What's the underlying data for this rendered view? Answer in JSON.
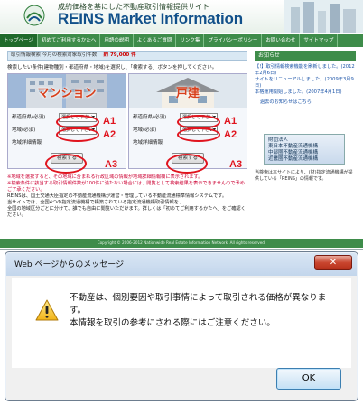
{
  "header": {
    "tagline": "成約価格を基にした不動産取引情報提供サイト",
    "brand": "REINS Market Information"
  },
  "nav": {
    "items": [
      "トップページ",
      "初めてご利用するかたへ",
      "用語の説明",
      "よくあるご質問",
      "リンク集",
      "プライバシーポリシー",
      "お問い合わせ",
      "サイトマップ"
    ]
  },
  "main": {
    "count_label": "取引情報検索",
    "count_text": "今月の検索対象取引件数：",
    "count_value": "約 79,000 件",
    "instruction": "検索したい条件(建物種別・都道府県・地域)を選択し、「検索する」ボタンを押してください。",
    "mansion": {
      "title": "マンション",
      "pref_label": "都道府県(必須)",
      "pref_value": "選択して下さい",
      "area_label": "地域(必須)",
      "area_value": "選択して下さい",
      "detail_label": "地域詳細情報",
      "search_label": "検索する"
    },
    "house": {
      "title": "戸建",
      "pref_label": "都道府県(必須)",
      "pref_value": "選択して下さい",
      "area_label": "地域(必須)",
      "area_value": "選択して下さい",
      "detail_label": "地域詳細情報",
      "search_label": "検索する"
    },
    "annotations": {
      "a1": "A1",
      "a2": "A2",
      "a3": "A3"
    },
    "notes": [
      "※地域を選択すると、その地域に含まれる行政区域の情報が地域詳細情報欄に表示されます。",
      "※検索条件に該当する取引情報件数が100件に満たない場合には、閲覧として検索結果を表示できませんので予めご了承ください。"
    ],
    "body_lines": [
      "REINSは、国土交通大臣指定の不動産流通機構が運営・管理している不動産流通標準情報システムです。",
      "当サイトでは、全国4つの指定流通機構で構築されている指定流通機構取引情報を、",
      "全国の地域区分ごとに分けて、誰でも自由に閲覧いただけます。詳しくは「初めてご利用するかたへ」をご確認ください。"
    ]
  },
  "side": {
    "heading": "お知らせ",
    "news": [
      "【!】取引情報検索機能を刷新しました。(2012年2月6日)",
      "サイトをリニューアルしました。(2009年3月9日)",
      "本格運用開始しました。(2007年4月1日)"
    ],
    "news_link": "過去のお知らせはこちら",
    "banner": [
      "財団法人",
      "東日本不動産流通機構",
      "中部圏不動産流通機構",
      "近畿圏不動産流通機構",
      "西日本不動産流通機構"
    ],
    "info": "当検索は本サイトにより、(財)指定流通機構が提供している「REINS」の情報です。"
  },
  "footer": {
    "copyright": "Copyright © 2006-2012 Nationwide Real Estate Information Network, All rights reserved."
  },
  "dialog": {
    "title": "Web ページからのメッセージ",
    "close_label": "✕",
    "message_line1": "不動産は、個別要因や取引事情によって取引される価格が異なりま",
    "message_line2": "す。",
    "message_line3": "本情報を取引の参考にされる際にはご注意ください。",
    "ok_label": "OK"
  },
  "colors": {
    "accent_green": "#3e8c4a",
    "brand_blue": "#11508a",
    "annotation_red": "#e0141e",
    "dialog_close_red": "#c9452e"
  }
}
